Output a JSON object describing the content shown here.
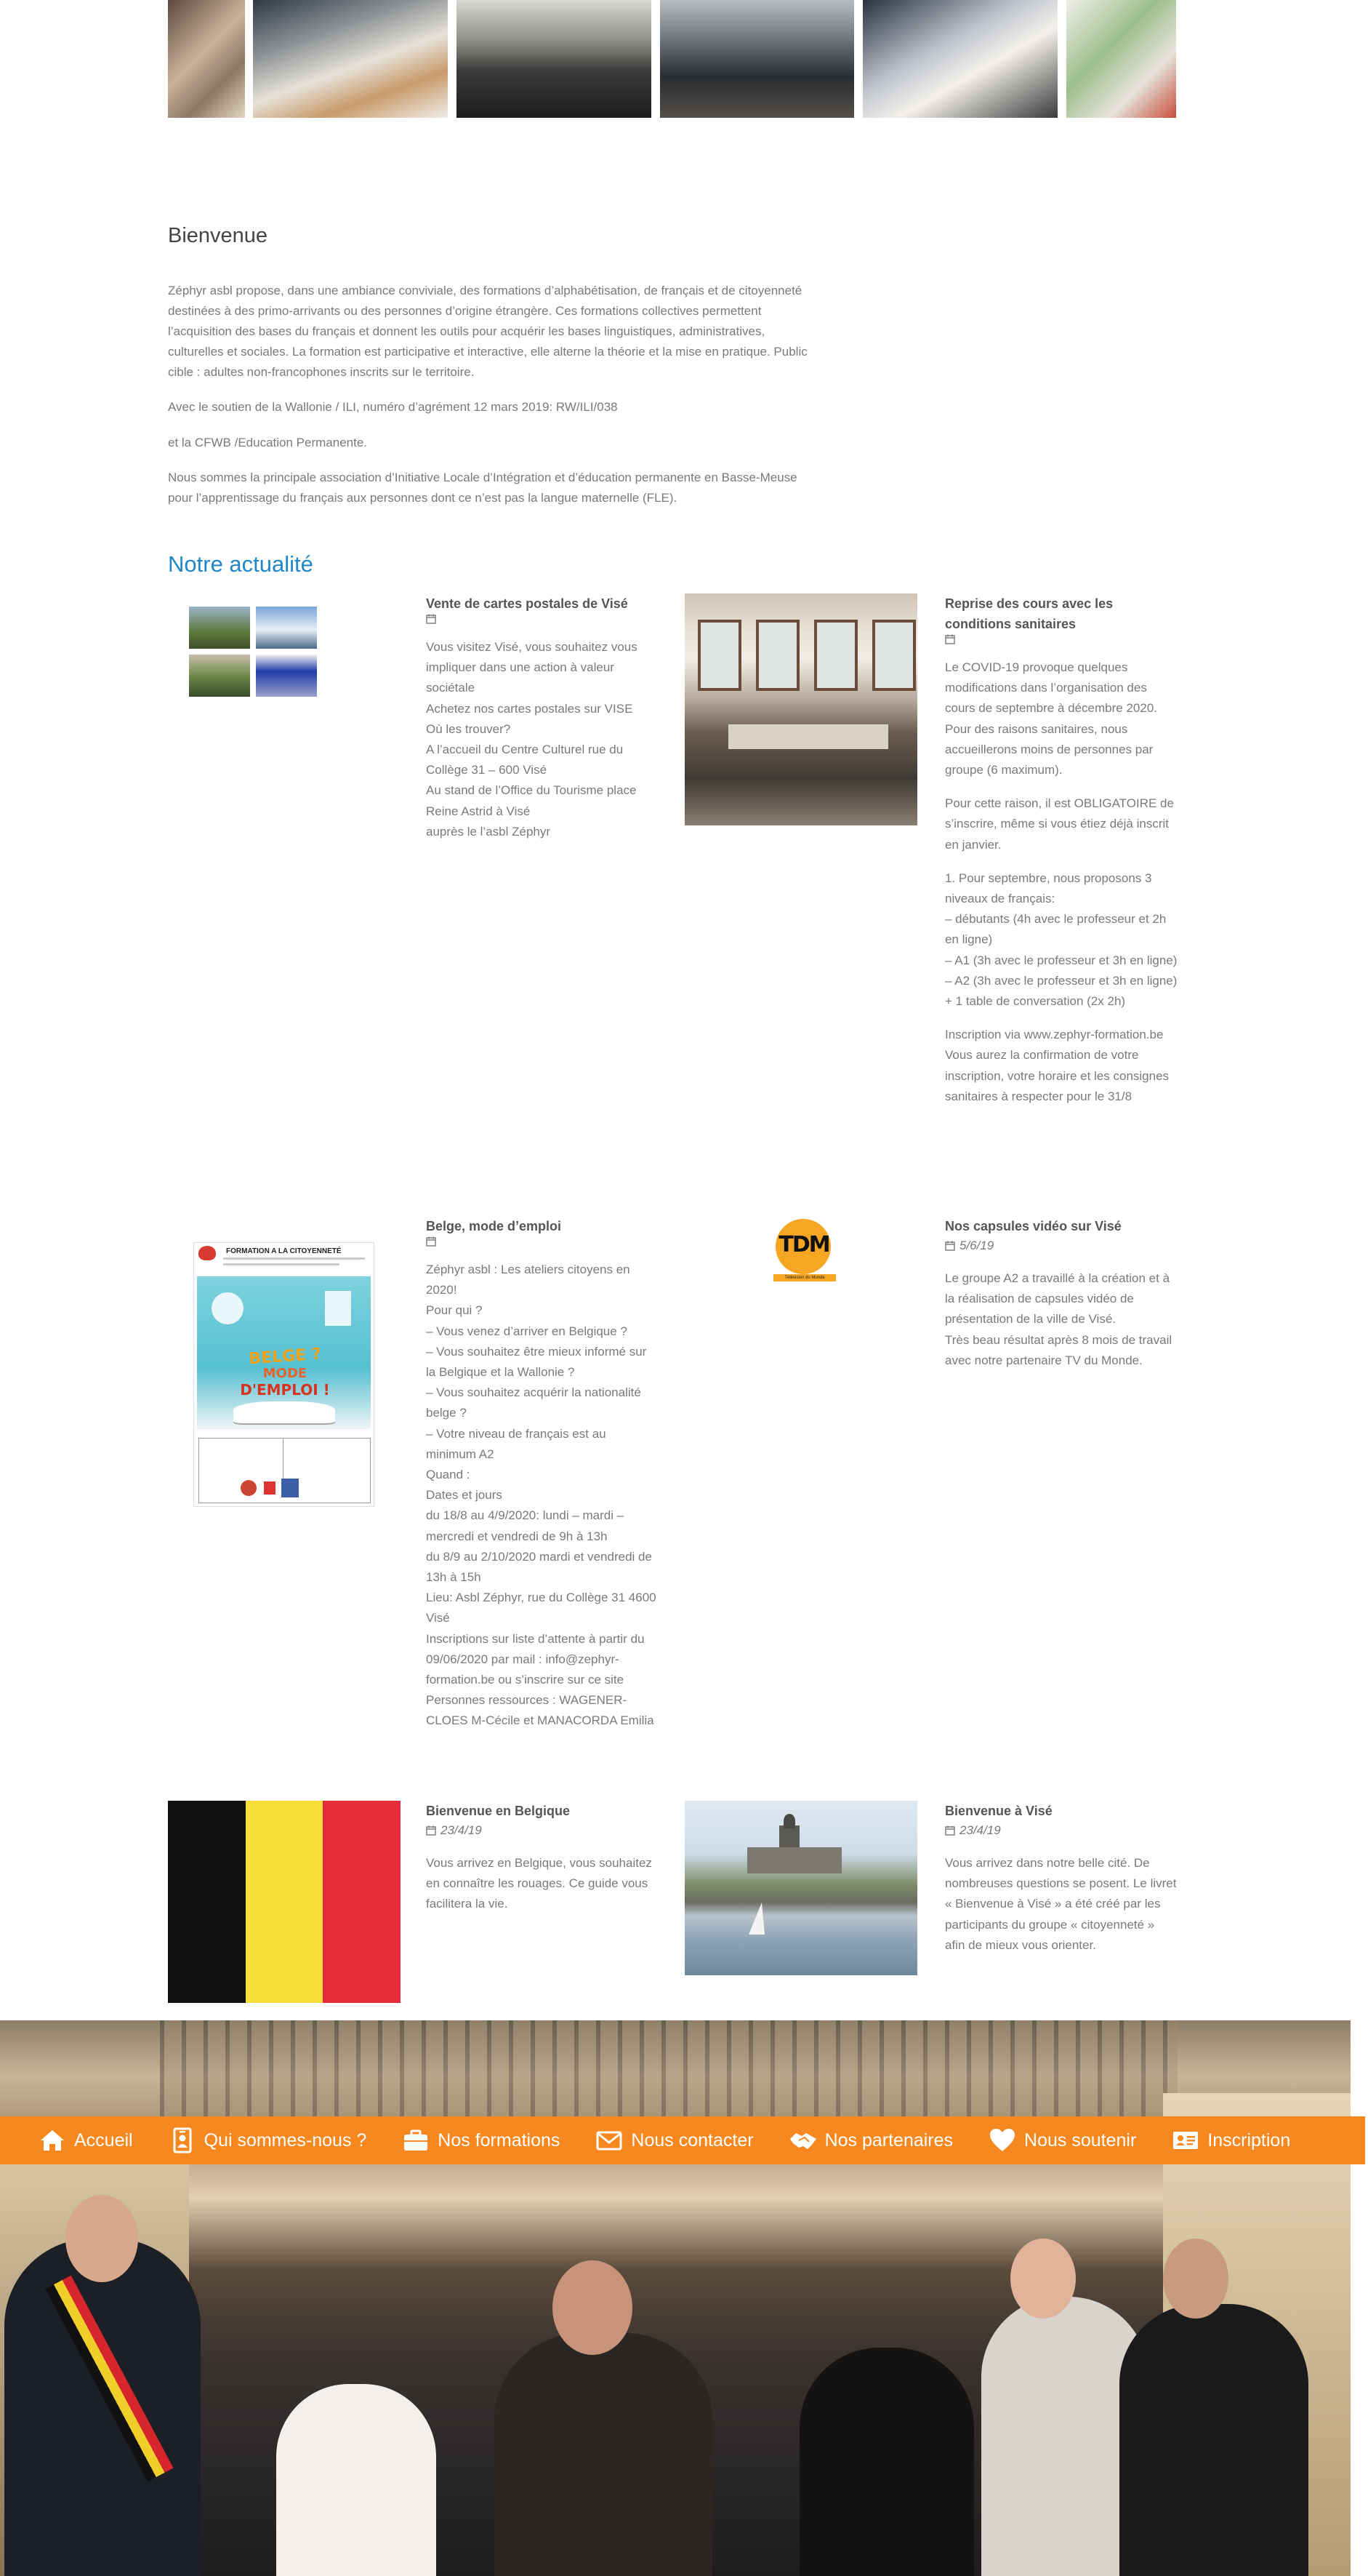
{
  "intro": {
    "title": "Bienvenue",
    "p1": "Zéphyr asbl propose, dans une ambiance conviviale, des formations d’alphabétisation, de français et de citoyenneté destinées à des primo-arrivants ou des personnes d’origine étrangère. Ces formations collectives permettent l’acquisition des bases du français et donnent les outils pour acquérir les bases linguistiques, administratives, culturelles et sociales. La formation est participative et interactive, elle alterne la théorie et la mise en pratique. Public cible : adultes non-francophones inscrits sur le territoire.",
    "p2": "Avec le soutien de la Wallonie / ILI, numéro d’agrément 12 mars 2019: RW/ILI/038",
    "p3": "et la CFWB /Education Permanente.",
    "p4": "Nous sommes la principale association d’Initiative Locale d’Intégration et d’éducation permanente en Basse-Meuse pour l’apprentissage du français aux personnes dont ce n’est pas la langue maternelle (FLE)."
  },
  "news": {
    "title": "Notre actualité",
    "posts": [
      {
        "title": "Vente de cartes postales de Visé",
        "date": "",
        "lines": [
          "Vous visitez Visé, vous souhaitez vous impliquer dans une action à valeur sociétale",
          "Achetez nos cartes postales sur VISE",
          "Où les trouver?",
          "A l’accueil du Centre Culturel rue du Collège 31 – 600 Visé",
          "Au stand de l’Office du Tourisme place Reine Astrid à Visé",
          "auprès le l’asbl Zéphyr"
        ]
      },
      {
        "title": "Reprise des cours avec les conditions sanitaires",
        "date": "",
        "p1": "Le COVID-19 provoque quelques modifications dans l’organisation des cours de septembre à décembre 2020. Pour des raisons sanitaires, nous accueillerons moins de personnes par groupe (6 maximum).",
        "p2": "Pour cette raison, il est OBLIGATOIRE de s’inscrire, même si vous étiez déjà inscrit en janvier.",
        "p3_lines": [
          "1. Pour septembre, nous proposons 3 niveaux de français:",
          "– débutants (4h avec le professeur et 2h en ligne)",
          "– A1 (3h avec le professeur et 3h en ligne)",
          "– A2 (3h avec le professeur et 3h en ligne)",
          "+ 1 table de conversation (2x 2h)"
        ],
        "p4_lines": [
          "Inscription via www.zephyr-formation.be",
          "Vous aurez la confirmation de votre inscription, votre horaire et les consignes sanitaires à respecter pour le 31/8"
        ]
      },
      {
        "title": "Belge, mode d’emploi",
        "date": "",
        "lines": [
          "Zéphyr asbl : Les ateliers citoyens en 2020!",
          "Pour qui ?",
          "– Vous venez d’arriver en Belgique ?",
          "– Vous souhaitez être mieux informé sur la Belgique et la Wallonie ?",
          "– Vous souhaitez acquérir la nationalité belge ?",
          "– Votre niveau de français est au minimum A2",
          "Quand :",
          "Dates et jours",
          "du 18/8 au 4/9/2020: lundi – mardi – mercredi et vendredi de 9h à 13h",
          "du 8/9 au 2/10/2020 mardi et vendredi de 13h à 15h",
          "Lieu: Asbl Zéphyr, rue du Collège 31 4600 Visé",
          "Inscriptions sur liste d’attente à partir du 09/06/2020 par mail : info@zephyr-formation.be ou s’inscrire sur ce site",
          "Personnes ressources : WAGENER-CLOES M-Cécile et MANACORDA Emilia"
        ],
        "poster": {
          "heading": "FORMATION A LA CITOYENNETÉ",
          "big1": "BELGE ?",
          "big2": "MODE",
          "big3": "D'EMPLOI !"
        }
      },
      {
        "title": "Nos capsules vidéo sur Visé",
        "date": "5/6/19",
        "lines": [
          "Le groupe A2 a travaillé à la création et à la réalisation de capsules vidéo de présentation de la ville de Visé.",
          "Très beau résultat après 8 mois de travail avec notre partenaire TV du Monde."
        ],
        "logo_text": "TDM",
        "logo_sub": "Télévision du Monde"
      },
      {
        "title": "Bienvenue en Belgique",
        "date": "23/4/19",
        "lines": [
          "Vous arrivez en Belgique, vous souhaitez en connaître les rouages. Ce guide vous facilitera la vie."
        ]
      },
      {
        "title": "Bienvenue à Visé",
        "date": "23/4/19",
        "lines": [
          "Vous arrivez dans notre belle cité. De nombreuses questions se posent. Le livret « Bienvenue à Visé » a été créé par les participants du groupe « citoyenneté » afin de mieux vous orienter."
        ]
      }
    ]
  },
  "nav": [
    {
      "label": "Accueil",
      "icon": "home-icon"
    },
    {
      "label": "Qui sommes-nous ?",
      "icon": "id-badge-icon"
    },
    {
      "label": "Nos formations",
      "icon": "briefcase-icon"
    },
    {
      "label": "Nous contacter",
      "icon": "envelope-icon"
    },
    {
      "label": "Nos partenaires",
      "icon": "handshake-icon"
    },
    {
      "label": "Nous soutenir",
      "icon": "heart-icon"
    },
    {
      "label": "Inscription",
      "icon": "id-card-icon"
    }
  ],
  "colors": {
    "accent": "#f7881f",
    "link": "#1e88c7",
    "flag_black": "#111111",
    "flag_yellow": "#f7de3a",
    "flag_red": "#e52a38"
  }
}
